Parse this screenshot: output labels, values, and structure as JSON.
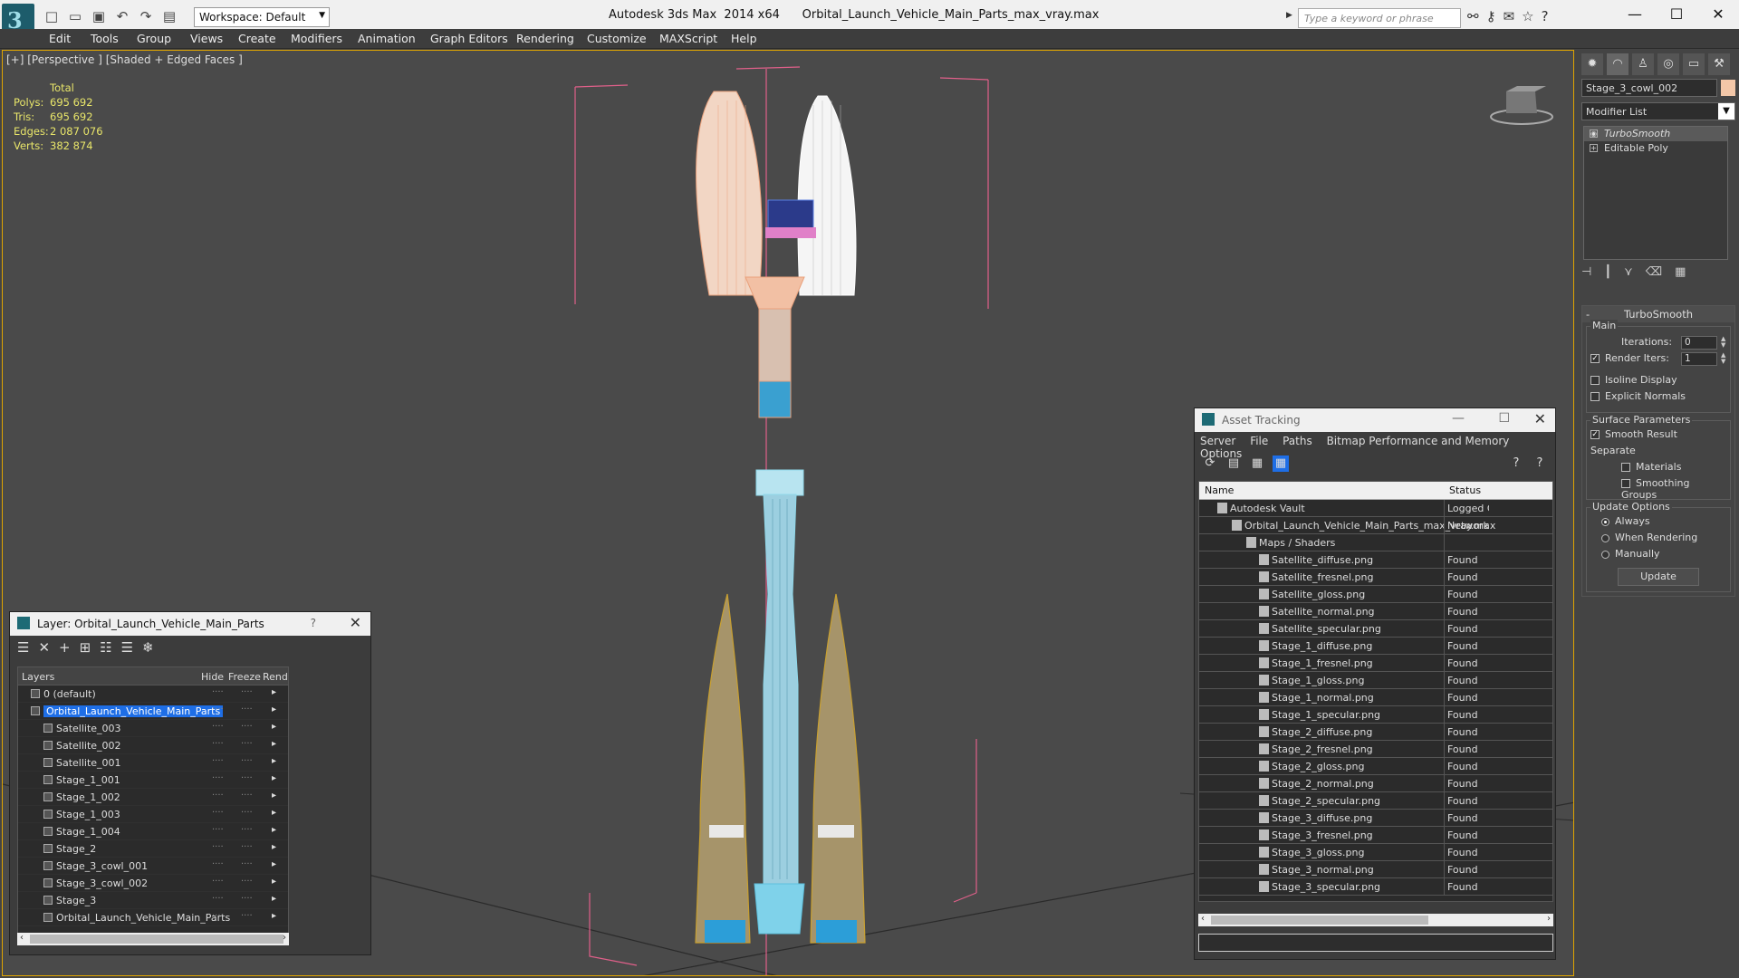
{
  "window": {
    "title": "Autodesk 3ds Max  2014 x64      Orbital_Launch_Vehicle_Main_Parts_max_vray.max",
    "workspace": "Workspace: Default",
    "search_placeholder": "Type a keyword or phrase"
  },
  "menu": [
    "Edit",
    "Tools",
    "Group",
    "Views",
    "Create",
    "Modifiers",
    "Animation",
    "Graph Editors",
    "Rendering",
    "Customize",
    "MAXScript",
    "Help"
  ],
  "viewport": {
    "label": "[+] [Perspective ] [Shaded + Edged Faces ]",
    "stats_header": "Total",
    "stats": [
      {
        "label": "Polys:",
        "value": "695 692"
      },
      {
        "label": "Tris:",
        "value": "695 692"
      },
      {
        "label": "Edges:",
        "value": "2 087 076"
      },
      {
        "label": "Verts:",
        "value": "382 874"
      }
    ]
  },
  "command_panel": {
    "object_name": "Stage_3_cowl_002",
    "modifier_list": "Modifier List",
    "stack": [
      "TurboSmooth",
      "Editable Poly"
    ],
    "rollout": "TurboSmooth",
    "main_group": "Main",
    "iterations_label": "Iterations:",
    "iterations_value": "0",
    "render_iters_label": "Render Iters:",
    "render_iters_value": "1",
    "isoline": "Isoline Display",
    "explicit_normals": "Explicit Normals",
    "surface_group": "Surface Parameters",
    "smooth_result": "Smooth Result",
    "separate": "Separate",
    "materials": "Materials",
    "smoothing_groups": "Smoothing Groups",
    "update_group": "Update Options",
    "always": "Always",
    "when_rendering": "When Rendering",
    "manually": "Manually",
    "update_button": "Update"
  },
  "layer_panel": {
    "title": "Layer: Orbital_Launch_Vehicle_Main_Parts",
    "help": "?",
    "columns": {
      "layers": "Layers",
      "hide": "Hide",
      "freeze": "Freeze",
      "render": "Render"
    },
    "rows": [
      {
        "name": "0 (default)",
        "level": 1
      },
      {
        "name": "Orbital_Launch_Vehicle_Main_Parts",
        "level": 1,
        "selected": true
      },
      {
        "name": "Satellite_003",
        "level": 2
      },
      {
        "name": "Satellite_002",
        "level": 2
      },
      {
        "name": "Satellite_001",
        "level": 2
      },
      {
        "name": "Stage_1_001",
        "level": 2
      },
      {
        "name": "Stage_1_002",
        "level": 2
      },
      {
        "name": "Stage_1_003",
        "level": 2
      },
      {
        "name": "Stage_1_004",
        "level": 2
      },
      {
        "name": "Stage_2",
        "level": 2
      },
      {
        "name": "Stage_3_cowl_001",
        "level": 2
      },
      {
        "name": "Stage_3_cowl_002",
        "level": 2
      },
      {
        "name": "Stage_3",
        "level": 2
      },
      {
        "name": "Orbital_Launch_Vehicle_Main_Parts",
        "level": 2
      }
    ]
  },
  "asset_panel": {
    "title": "Asset Tracking",
    "menu": [
      "Server",
      "File",
      "Paths",
      "Bitmap Performance and Memory",
      "Options"
    ],
    "columns": {
      "name": "Name",
      "status": "Status"
    },
    "rows": [
      {
        "name": "Autodesk Vault",
        "status": "Logged O",
        "level": 1
      },
      {
        "name": "Orbital_Launch_Vehicle_Main_Parts_max_vray.max",
        "status": "Network P",
        "level": 2
      },
      {
        "name": "Maps / Shaders",
        "status": "",
        "level": 3
      },
      {
        "name": "Satellite_diffuse.png",
        "status": "Found",
        "level": 4
      },
      {
        "name": "Satellite_fresnel.png",
        "status": "Found",
        "level": 4
      },
      {
        "name": "Satellite_gloss.png",
        "status": "Found",
        "level": 4
      },
      {
        "name": "Satellite_normal.png",
        "status": "Found",
        "level": 4
      },
      {
        "name": "Satellite_specular.png",
        "status": "Found",
        "level": 4
      },
      {
        "name": "Stage_1_diffuse.png",
        "status": "Found",
        "level": 4
      },
      {
        "name": "Stage_1_fresnel.png",
        "status": "Found",
        "level": 4
      },
      {
        "name": "Stage_1_gloss.png",
        "status": "Found",
        "level": 4
      },
      {
        "name": "Stage_1_normal.png",
        "status": "Found",
        "level": 4
      },
      {
        "name": "Stage_1_specular.png",
        "status": "Found",
        "level": 4
      },
      {
        "name": "Stage_2_diffuse.png",
        "status": "Found",
        "level": 4
      },
      {
        "name": "Stage_2_fresnel.png",
        "status": "Found",
        "level": 4
      },
      {
        "name": "Stage_2_gloss.png",
        "status": "Found",
        "level": 4
      },
      {
        "name": "Stage_2_normal.png",
        "status": "Found",
        "level": 4
      },
      {
        "name": "Stage_2_specular.png",
        "status": "Found",
        "level": 4
      },
      {
        "name": "Stage_3_diffuse.png",
        "status": "Found",
        "level": 4
      },
      {
        "name": "Stage_3_fresnel.png",
        "status": "Found",
        "level": 4
      },
      {
        "name": "Stage_3_gloss.png",
        "status": "Found",
        "level": 4
      },
      {
        "name": "Stage_3_normal.png",
        "status": "Found",
        "level": 4
      },
      {
        "name": "Stage_3_specular.png",
        "status": "Found",
        "level": 4
      }
    ]
  },
  "colors": {
    "accent": "#1e6ee6",
    "stats": "#e9e66a",
    "viewport_border": "#e0a500",
    "wire_fairing": "#f0b090",
    "wire_white": "#ffffff",
    "wire_core": "#8fd8ea",
    "wire_booster": "#c9a030"
  }
}
